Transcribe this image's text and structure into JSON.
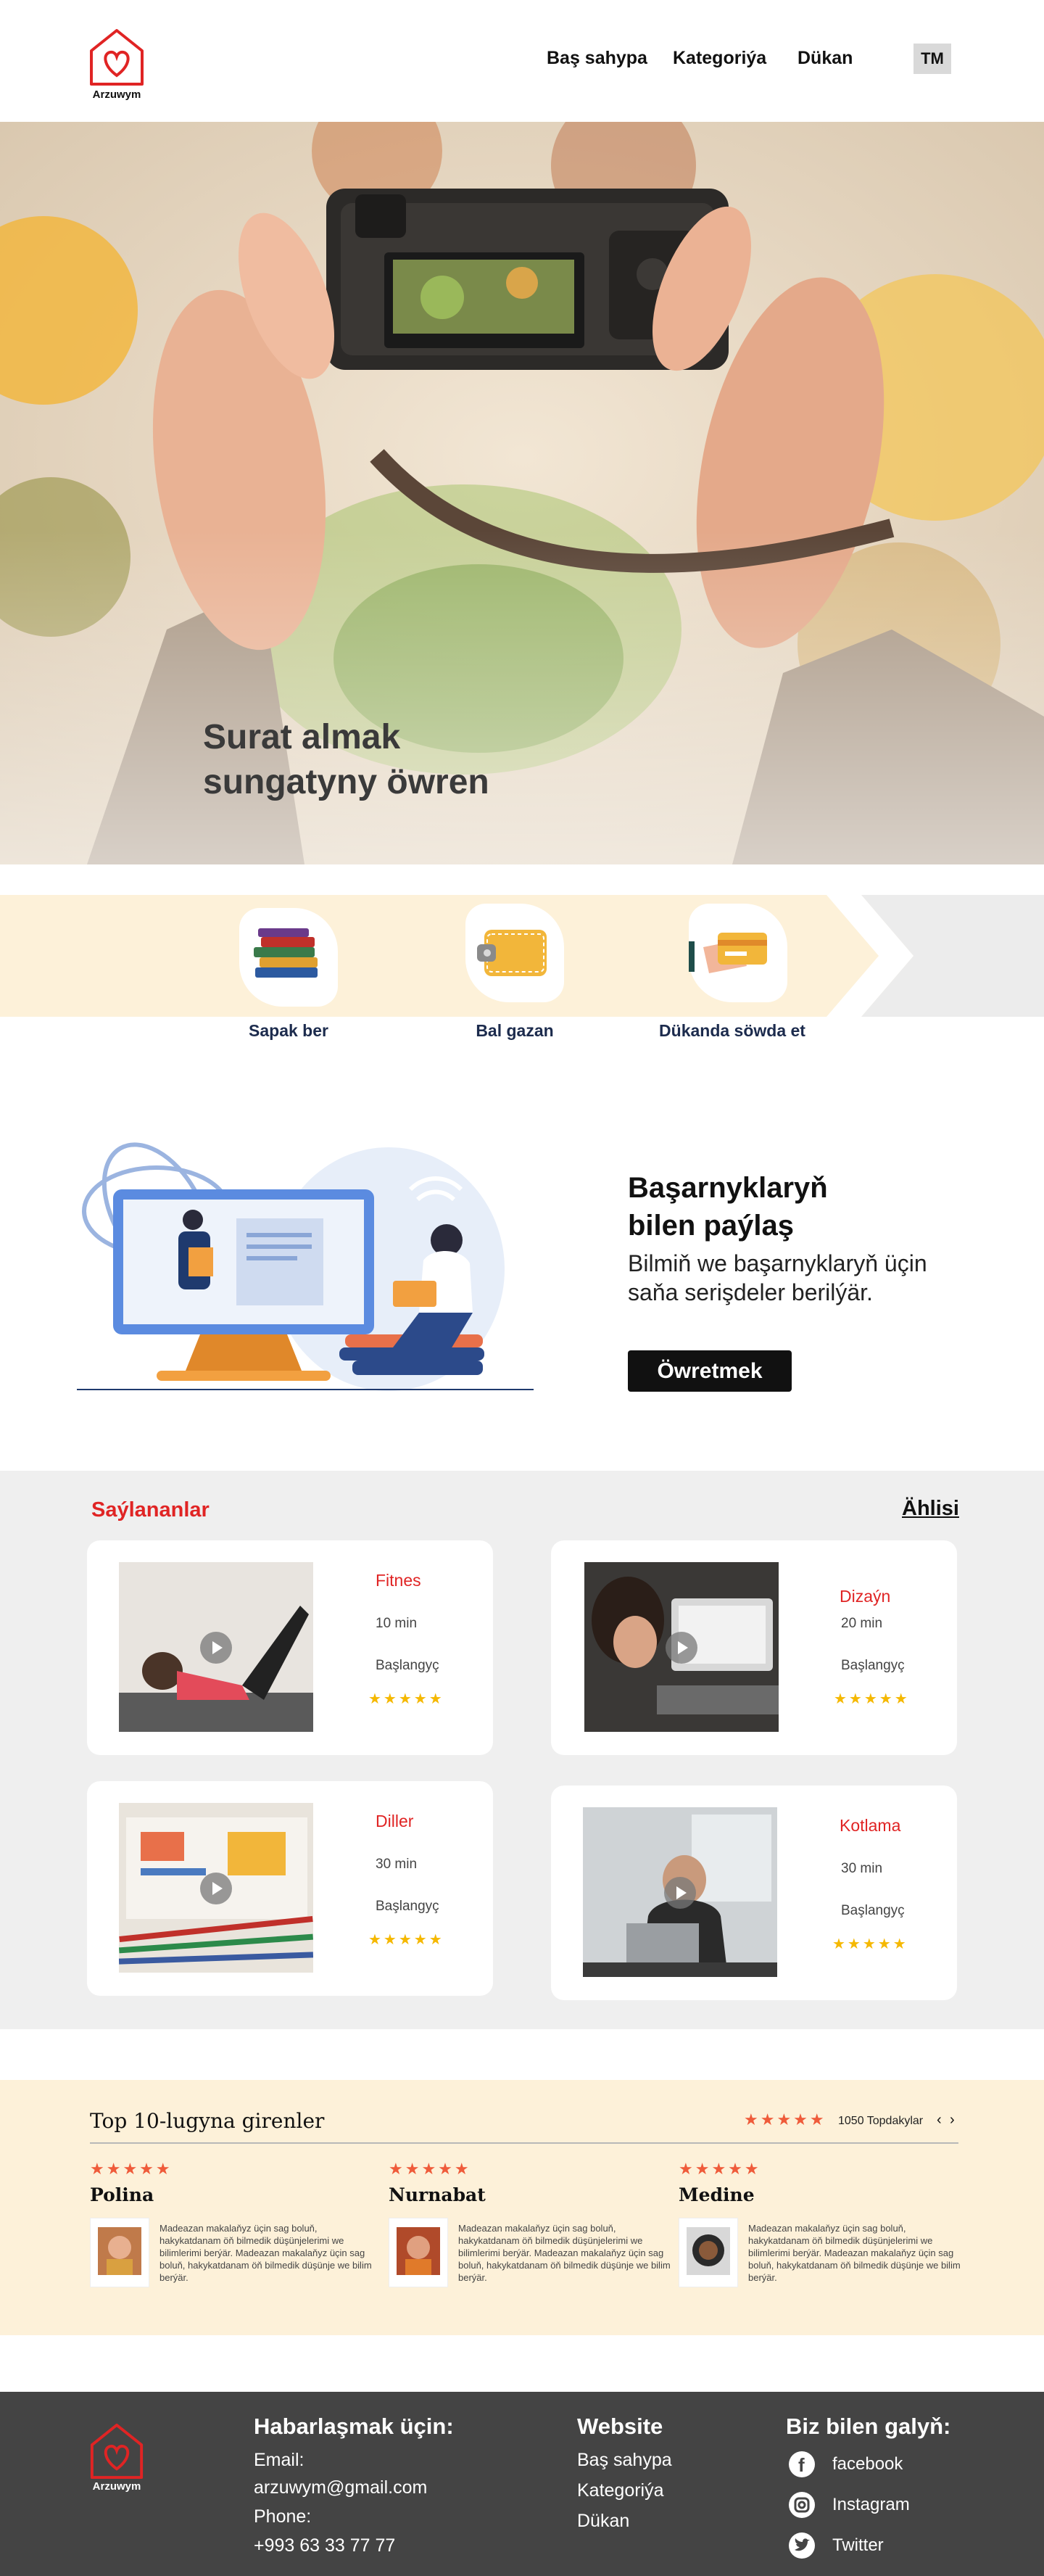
{
  "header": {
    "logo_text": "Arzuwym",
    "nav": [
      "Baş sahypa",
      "Kategoriýa",
      "Dükan"
    ],
    "language": "TM"
  },
  "hero": {
    "title_line1": "Surat almak",
    "title_line2": "sungatyny öwren"
  },
  "features": [
    {
      "label": "Sapak ber",
      "icon": "books-icon"
    },
    {
      "label": "Bal gazan",
      "icon": "wallet-icon"
    },
    {
      "label": "Dükanda söwda et",
      "icon": "card-payment-icon"
    }
  ],
  "teach": {
    "title_line1": "Başarnyklaryň",
    "title_line2": "bilen paýlaş",
    "subtitle": "Bilmiň we başarnyklaryň üçin  saňa serişdeler berilýär.",
    "button": "Öwretmek"
  },
  "popular": {
    "title": "Saýlananlar",
    "all_link": "Ählisi",
    "courses": [
      {
        "name": "Fitnes",
        "duration": "10 min",
        "level": "Başlangyç",
        "stars": "★★★★★"
      },
      {
        "name": "Dizaýn",
        "duration": "20 min",
        "level": "Başlangyç",
        "stars": "★★★★★"
      },
      {
        "name": "Diller",
        "duration": "30 min",
        "level": "Başlangyç",
        "stars": "★★★★★"
      },
      {
        "name": "Kotlama",
        "duration": "30 min",
        "level": "Başlangyç",
        "stars": "★★★★★"
      }
    ]
  },
  "top10": {
    "title": "Top 10-lugyna girenler",
    "stars": "★★★★★",
    "count": "1050 Topdakylar",
    "prev": "‹",
    "next": "›",
    "reviews": [
      {
        "name": "Polina",
        "stars": "★★★★★",
        "text": "Madeazan makalaňyz üçin sag boluň, hakykatdanam öň bilmedik düşünjelerimi we bilimlerimi berýär. Madeazan makalaňyz üçin sag boluň, hakykatdanam öň bilmedik düşünje we bilim berýär."
      },
      {
        "name": "Nurnabat",
        "stars": "★★★★★",
        "text": "Madeazan makalaňyz üçin sag boluň, hakykatdanam öň bilmedik düşünjelerimi we bilimlerimi berýär. Madeazan makalaňyz üçin sag boluň, hakykatdanam öň bilmedik düşünje we bilim berýär."
      },
      {
        "name": "Medine",
        "stars": "★★★★★",
        "text": "Madeazan makalaňyz üçin sag boluň, hakykatdanam öň bilmedik düşünjelerimi we bilimlerimi berýär. Madeazan makalaňyz üçin sag boluň, hakykatdanam öň bilmedik düşünje we bilim berýär."
      }
    ]
  },
  "footer": {
    "logo_text": "Arzuwym",
    "contact_title": "Habarlaşmak üçin:",
    "email_label": "Email:",
    "email": "arzuwym@gmail.com",
    "phone_label": "Phone:",
    "phone": "+993 63 33 77 77",
    "website_title": "Website",
    "links": [
      "Baş sahypa",
      "Kategoriýa",
      "Dükan"
    ],
    "social_title": "Biz bilen galyň:",
    "socials": [
      "facebook",
      "Instagram",
      "Twitter"
    ]
  }
}
